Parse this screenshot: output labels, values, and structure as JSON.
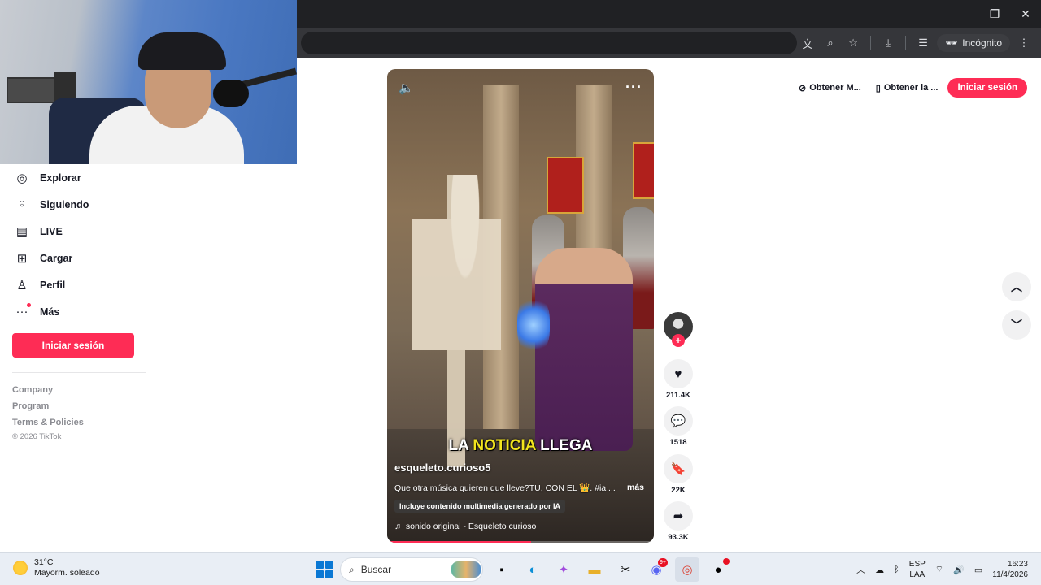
{
  "browser": {
    "incognito_label": "Incógnito",
    "icons": [
      "translate-icon",
      "zoom-icon",
      "star-icon",
      "download-icon",
      "tab-search-icon",
      "incognito-icon",
      "kebab-menu-icon"
    ]
  },
  "sidebar": {
    "items": [
      {
        "label": "Explorar",
        "icon": "compass-icon"
      },
      {
        "label": "Siguiendo",
        "icon": "following-icon"
      },
      {
        "label": "LIVE",
        "icon": "live-icon"
      },
      {
        "label": "Cargar",
        "icon": "upload-icon"
      },
      {
        "label": "Perfil",
        "icon": "profile-icon"
      },
      {
        "label": "Más",
        "icon": "more-dots-icon"
      }
    ],
    "login_label": "Iniciar sesión",
    "footer_links": [
      "Company",
      "Program",
      "Terms & Policies"
    ],
    "copyright": "© 2026 TikTok"
  },
  "top_actions": {
    "get_app_1": "Obtener M...",
    "get_app_2": "Obtener la ...",
    "login_label": "Iniciar sesión"
  },
  "video": {
    "caption_pre": "LA ",
    "caption_highlight": "NOTICIA",
    "caption_post": " LLEGA",
    "author": "esqueleto.curioso5",
    "description": "Que otra música quieren que lleve?TU, CON EL 👑. #ia ...",
    "more_label": "más",
    "ai_badge": "Incluye contenido multimedia generado por IA",
    "sound": "sonido original - Esqueleto curioso",
    "progress": 0.54
  },
  "actions": {
    "likes": "211.4K",
    "comments": "1518",
    "saves": "22K",
    "shares": "93.3K"
  },
  "taskbar": {
    "temperature": "31°C",
    "weather": "Mayorm. soleado",
    "search_placeholder": "Buscar",
    "notification_count": "9+",
    "lang_1": "ESP",
    "lang_2": "LAA",
    "time": "16:23",
    "date": "11/4/2026"
  },
  "colors": {
    "accent": "#fe2c55",
    "caption_highlight": "#f3e51e",
    "chrome_dark": "#202124"
  }
}
